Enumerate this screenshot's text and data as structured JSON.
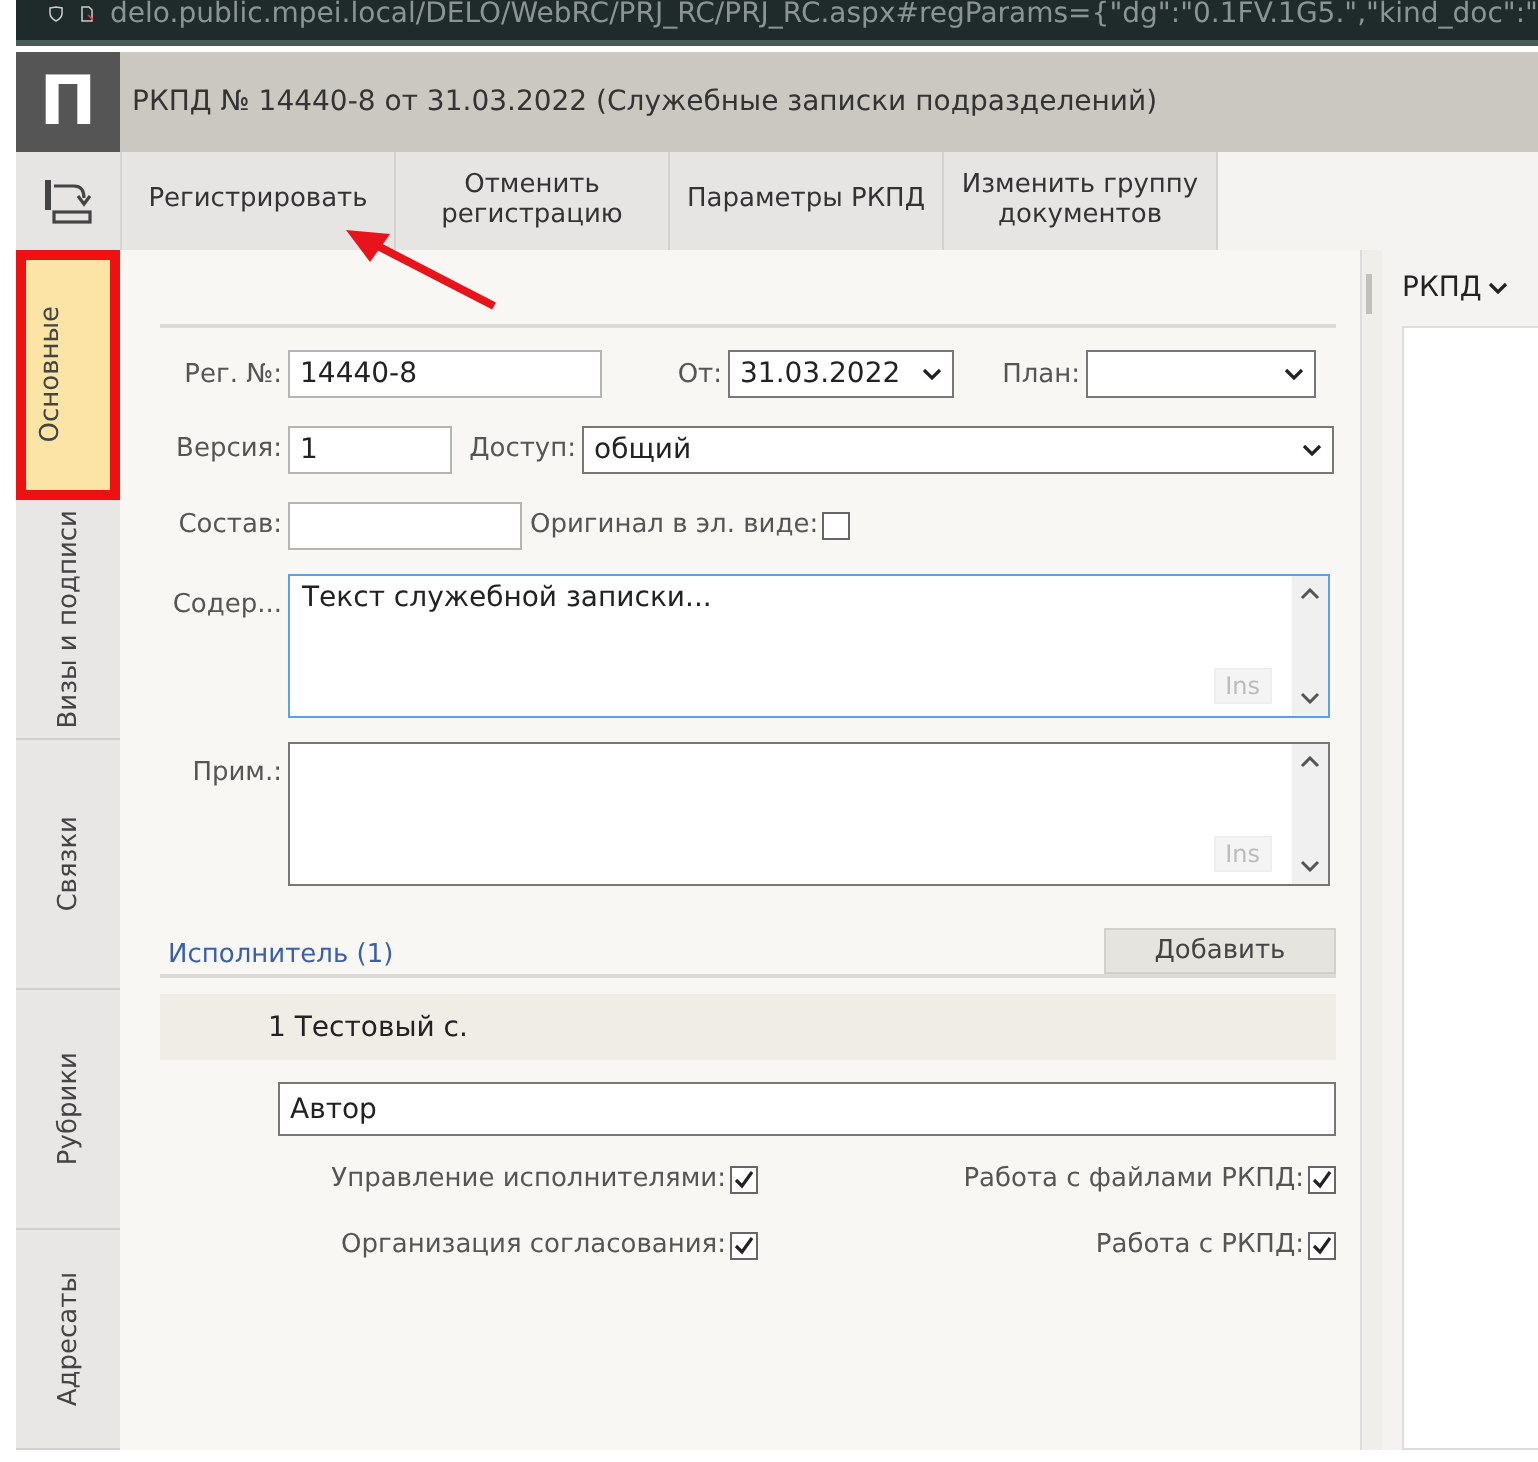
{
  "browser": {
    "url": "delo.public.mpei.local/DELO/WebRC/PRJ_RC/PRJ_RC.aspx#regParams={\"dg\":\"0.1FV.1G5.\",\"kind_doc\":\""
  },
  "header": {
    "logo": "П",
    "title": "РКПД №  14440-8 от 31.03.2022 (Служебные записки подразделений)"
  },
  "toolbar": {
    "buttons": [
      "Регистрировать",
      "Отменить регистрацию",
      "Параметры РКПД",
      "Изменить группу документов"
    ]
  },
  "side_tabs": [
    {
      "label": "Основные",
      "selected": true,
      "highlighted": true
    },
    {
      "label": "Визы и подписи",
      "selected": false,
      "highlighted": false
    },
    {
      "label": "Связки",
      "selected": false,
      "highlighted": false
    },
    {
      "label": "Рубрики",
      "selected": false,
      "highlighted": false
    },
    {
      "label": "Адресаты",
      "selected": false,
      "highlighted": false
    }
  ],
  "form": {
    "reg_no": {
      "label": "Рег. №:",
      "value": "14440-8"
    },
    "date": {
      "label": "От:",
      "value": "31.03.2022"
    },
    "plan": {
      "label": "План:"
    },
    "version": {
      "label": "Версия:",
      "value": "1"
    },
    "access": {
      "label": "Доступ:",
      "value": "общий"
    },
    "composition": {
      "label": "Состав:"
    },
    "original": {
      "label": "Оригинал в эл. виде:",
      "checked": false
    },
    "content": {
      "label": "Содер...",
      "value": "Текст служебной записки...",
      "focused": true,
      "ins": "Ins"
    },
    "note": {
      "label": "Прим.:",
      "focused": false,
      "ins": "Ins"
    }
  },
  "executors": {
    "title": "Исполнитель (1)",
    "add_button": "Добавить",
    "rows": [
      {
        "label": "1 Тестовый с.",
        "role": "Автор",
        "permissions": [
          {
            "label": "Управление исполнителями:",
            "checked": true
          },
          {
            "label": "Работа с файлами РКПД:",
            "checked": true
          },
          {
            "label": "Организация согласования:",
            "checked": true
          },
          {
            "label": "Работа с РКПД:",
            "checked": true
          }
        ]
      }
    ]
  },
  "right_panel": {
    "dropdown": "РКПД"
  }
}
